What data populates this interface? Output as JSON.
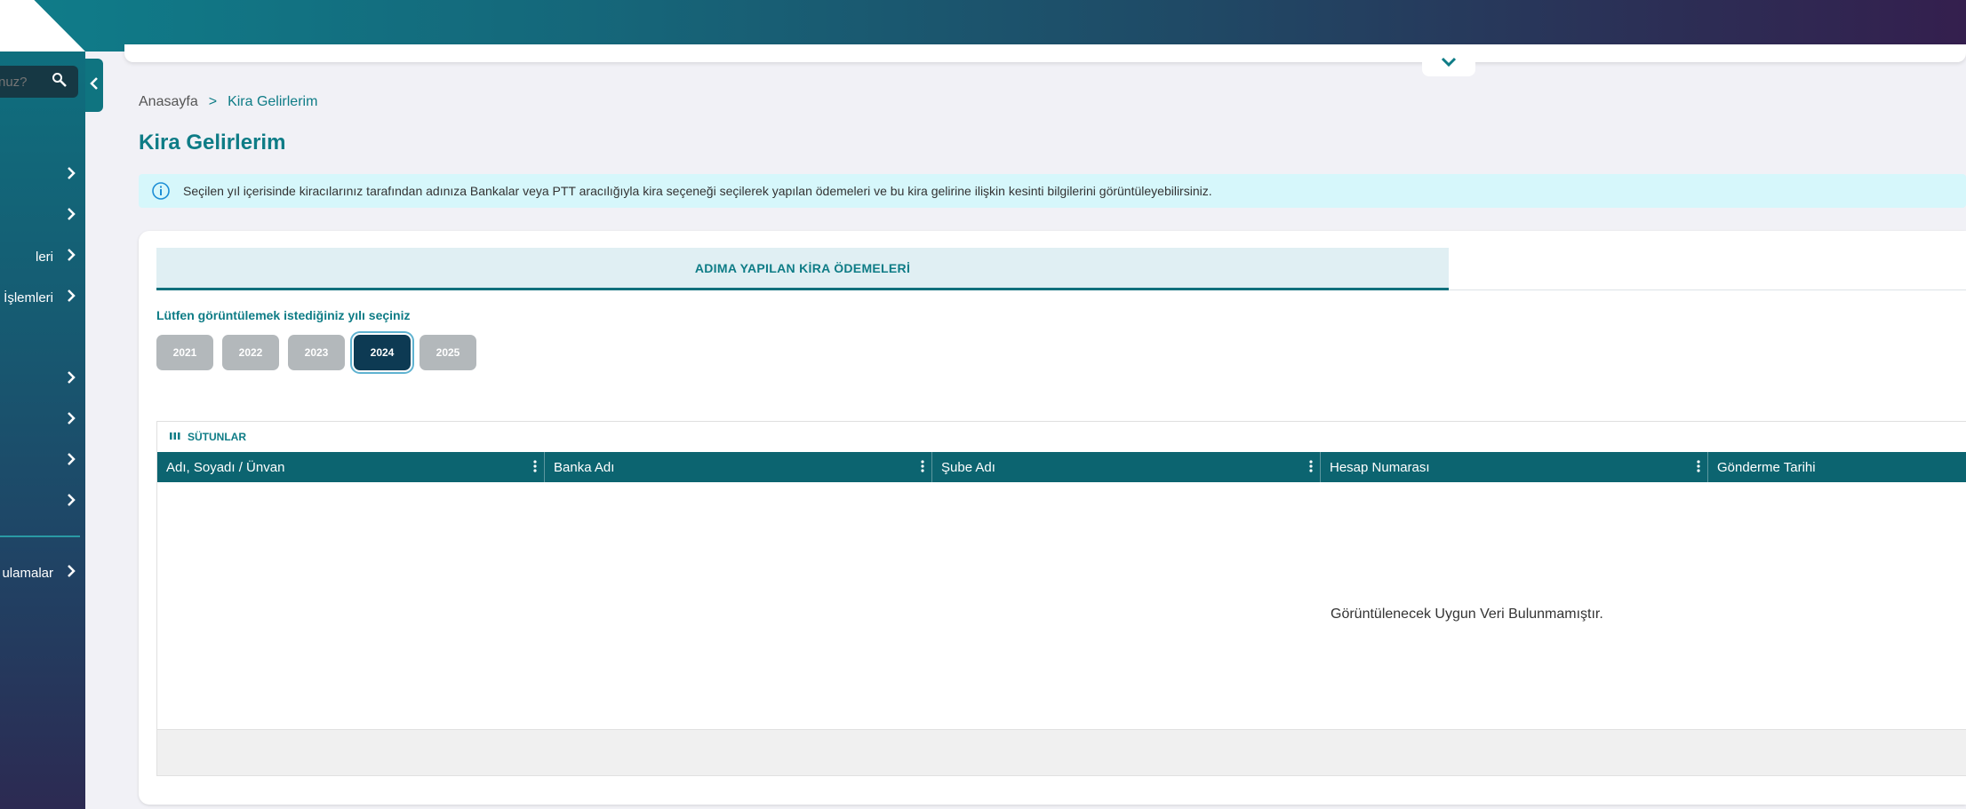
{
  "header": {
    "collapse_icon": "chevron-down-icon"
  },
  "sidebar": {
    "search": {
      "placeholder": "nuz?"
    },
    "items": [
      {
        "label": "",
        "icon": "chevron-right-icon"
      },
      {
        "label": "",
        "icon": "chevron-right-icon"
      },
      {
        "label": "leri",
        "icon": "chevron-right-icon"
      },
      {
        "label": "l İşlemleri",
        "icon": "chevron-right-icon"
      },
      {
        "label": "",
        "icon": "chevron-right-icon"
      },
      {
        "label": "",
        "icon": "chevron-right-icon"
      },
      {
        "label": "",
        "icon": "chevron-right-icon"
      },
      {
        "label": "",
        "icon": "chevron-right-icon"
      },
      {
        "label": "ulamalar",
        "icon": "chevron-right-icon"
      }
    ]
  },
  "breadcrumb": {
    "home": "Anasayfa",
    "separator": ">",
    "current": "Kira Gelirlerim"
  },
  "page": {
    "title": "Kira Gelirlerim",
    "info": "Seçilen yıl içerisinde kiracılarınız tarafından adınıza Bankalar veya PTT aracılığıyla kira seçeneği seçilerek yapılan ödemeleri ve bu kira gelirine ilişkin kesinti bilgilerini görüntüleyebilirsiniz."
  },
  "tabs": [
    {
      "label": "ADIMA YAPILAN KİRA ÖDEMELERİ",
      "active": true
    }
  ],
  "year_selector": {
    "prompt": "Lütfen görüntülemek istediğiniz yılı seçiniz",
    "years": [
      "2021",
      "2022",
      "2023",
      "2024",
      "2025"
    ],
    "selected": "2024"
  },
  "grid": {
    "columns_button": "SÜTUNLAR",
    "columns": [
      "Adı, Soyadı / Ünvan",
      "Banka Adı",
      "Şube Adı",
      "Hesap Numarası",
      "Gönderme Tarihi"
    ],
    "empty_message": "Görüntülenecek Uygun Veri Bulunmamıştır."
  },
  "colors": {
    "accent": "#0e7c86",
    "header_dark": "#0c6470",
    "selected_year": "#0d3a53",
    "info_bg": "#d6f7fb"
  }
}
